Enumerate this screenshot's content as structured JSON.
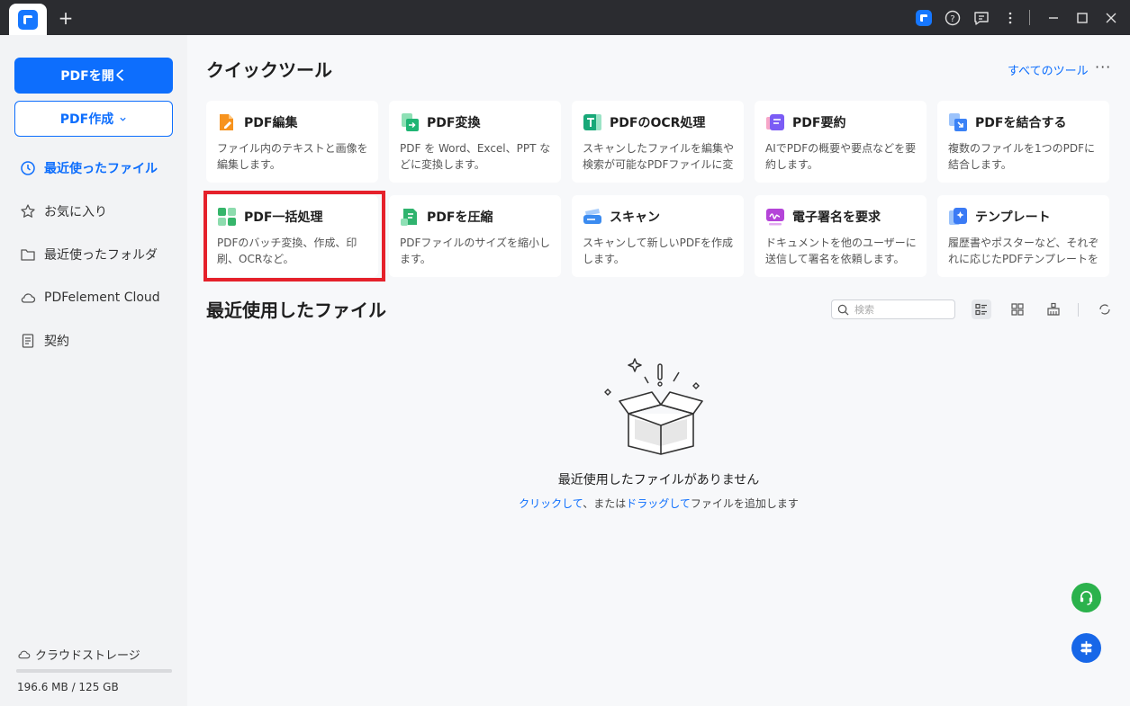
{
  "titlebar": {
    "new_tab_symbol": "+",
    "icons": [
      "app-logo",
      "help-icon",
      "feedback-icon",
      "more-vertical-icon",
      "minimize-icon",
      "maximize-icon",
      "close-icon"
    ]
  },
  "sidebar": {
    "open_pdf_label": "PDFを開く",
    "create_pdf_label": "PDF作成",
    "nav": [
      {
        "label": "最近使ったファイル",
        "icon": "clock-icon",
        "active": true
      },
      {
        "label": "お気に入り",
        "icon": "star-icon",
        "active": false
      },
      {
        "label": "最近使ったフォルダ",
        "icon": "folder-icon",
        "active": false
      },
      {
        "label": "PDFelement Cloud",
        "icon": "cloud-icon",
        "active": false
      },
      {
        "label": "契約",
        "icon": "document-icon",
        "active": false
      }
    ],
    "storage": {
      "label": "クラウドストレージ",
      "usage": "196.6 MB / 125 GB",
      "used_fraction": 1.0
    }
  },
  "quick_tools": {
    "title": "クイックツール",
    "all_tools_label": "すべてのツール",
    "more_label": "···",
    "cards": [
      {
        "title": "PDF編集",
        "desc": "ファイル内のテキストと画像を編集します。",
        "icon": "edit-icon",
        "color": "#f7931e"
      },
      {
        "title": "PDF変換",
        "desc": "PDF を Word、Excel、PPT などに変換します。",
        "icon": "convert-icon",
        "color": "#1fb574"
      },
      {
        "title": "PDFのOCR処理",
        "desc": "スキャンしたファイルを編集や検索が可能なPDFファイルに変換します。",
        "icon": "ocr-icon",
        "color": "#18a878"
      },
      {
        "title": "PDF要約",
        "desc": "AIでPDFの概要や要点などを要約します。",
        "icon": "summary-icon",
        "color": "#7b5cf5"
      },
      {
        "title": "PDFを結合する",
        "desc": "複数のファイルを1つのPDFに結合します。",
        "icon": "merge-icon",
        "color": "#3b82f6"
      },
      {
        "title": "PDF一括処理",
        "desc": "PDFのバッチ変換、作成、印刷、OCRなど。",
        "icon": "batch-icon",
        "color": "#35b56a"
      },
      {
        "title": "PDFを圧縮",
        "desc": "PDFファイルのサイズを縮小します。",
        "icon": "compress-icon",
        "color": "#2fb36e"
      },
      {
        "title": "スキャン",
        "desc": "スキャンして新しいPDFを作成します。",
        "icon": "scan-icon",
        "color": "#3b8bf0"
      },
      {
        "title": "電子署名を要求",
        "desc": "ドキュメントを他のユーザーに送信して署名を依頼します。",
        "icon": "signature-icon",
        "color": "#b444d8"
      },
      {
        "title": "テンプレート",
        "desc": "履歴書やポスターなど、それぞれに応じたPDFテンプレートを提供します。",
        "icon": "template-icon",
        "color": "#3b7bf5"
      }
    ]
  },
  "recent": {
    "title": "最近使用したファイル",
    "search_placeholder": "検索",
    "empty_title": "最近使用したファイルがありません",
    "empty_click": "クリックして",
    "empty_mid": "、または",
    "empty_drag": "ドラッグして",
    "empty_tail": "ファイルを追加します"
  },
  "colors": {
    "accent": "#0d6efd",
    "highlight": "#e5212b",
    "support": "#2bb24c"
  }
}
